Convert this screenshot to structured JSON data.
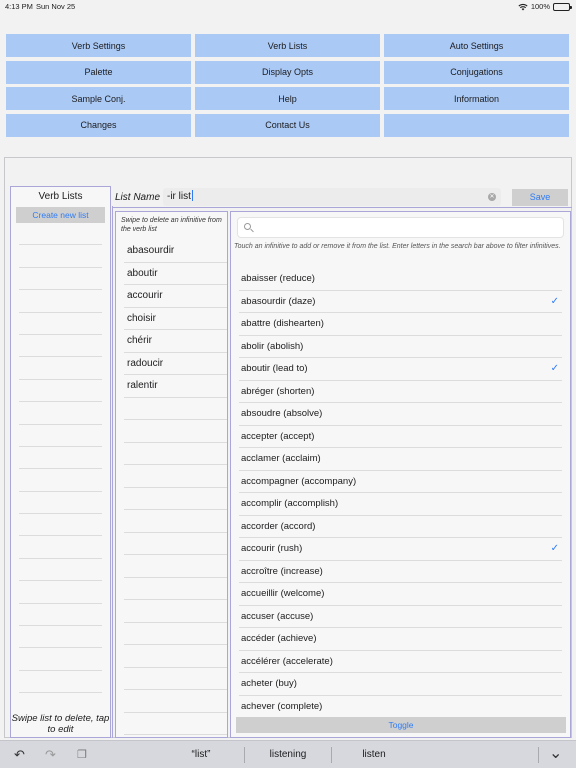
{
  "status_bar": {
    "time": "4:13 PM",
    "date": "Sun Nov 25",
    "battery": "100%"
  },
  "top_buttons": [
    "Verb Settings",
    "Verb Lists",
    "Auto Settings",
    "Palette",
    "Display Opts",
    "Conjugations",
    "Sample Conj.",
    "Help",
    "Information",
    "Changes",
    "Contact Us",
    ""
  ],
  "lists_panel": {
    "title": "Verb Lists",
    "create_button": "Create new list",
    "swipe_note": "Swipe list to delete, tap to edit"
  },
  "list_name": {
    "label": "List Name",
    "value": "-ir list",
    "save_button": "Save"
  },
  "verbs_panel": {
    "note": "Swipe to delete an infinitive from the verb list",
    "items": [
      "abasourdir",
      "aboutir",
      "accourir",
      "choisir",
      "chérir",
      "radoucir",
      "ralentir"
    ]
  },
  "all_verbs_panel": {
    "search_placeholder": "",
    "hint": "Touch an infinitive to add or remove it from the list. Enter letters in the search bar above to filter infinitives.",
    "items": [
      {
        "label": "abaisser (reduce)",
        "checked": false
      },
      {
        "label": "abasourdir (daze)",
        "checked": true
      },
      {
        "label": "abattre (dishearten)",
        "checked": false
      },
      {
        "label": "abolir (abolish)",
        "checked": false
      },
      {
        "label": "aboutir (lead to)",
        "checked": true
      },
      {
        "label": "abréger (shorten)",
        "checked": false
      },
      {
        "label": "absoudre (absolve)",
        "checked": false
      },
      {
        "label": "accepter (accept)",
        "checked": false
      },
      {
        "label": "acclamer (acclaim)",
        "checked": false
      },
      {
        "label": "accompagner (accompany)",
        "checked": false
      },
      {
        "label": "accomplir (accomplish)",
        "checked": false
      },
      {
        "label": "accorder (accord)",
        "checked": false
      },
      {
        "label": "accourir (rush)",
        "checked": true
      },
      {
        "label": "accroître (increase)",
        "checked": false
      },
      {
        "label": "accueillir (welcome)",
        "checked": false
      },
      {
        "label": "accuser (accuse)",
        "checked": false
      },
      {
        "label": "accéder (achieve)",
        "checked": false
      },
      {
        "label": "accélérer (accelerate)",
        "checked": false
      },
      {
        "label": "acheter (buy)",
        "checked": false
      },
      {
        "label": "achever (complete)",
        "checked": false
      }
    ],
    "toggle_button": "Toggle",
    "check_glyph": "✓"
  },
  "keyboard_bar": {
    "suggestions": [
      "“list”",
      "listening",
      "listen"
    ],
    "undo_icon": "↶",
    "redo_icon": "↷",
    "clipboard_icon": "❐",
    "collapse_icon": "⌄"
  }
}
